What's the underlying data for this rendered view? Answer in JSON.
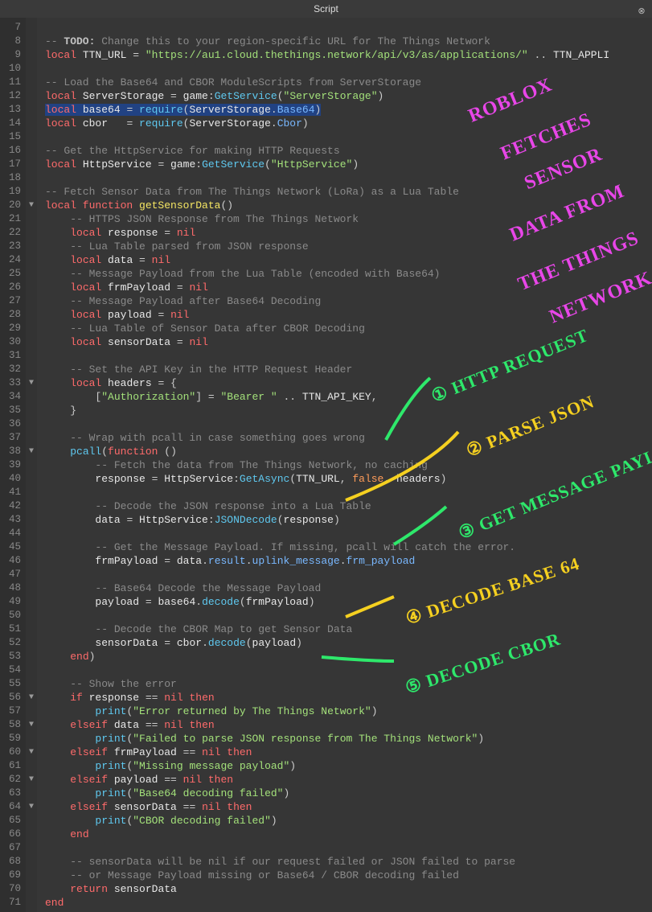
{
  "window": {
    "title": "Script"
  },
  "first_line_no": 7,
  "fold_lines": [
    20,
    33,
    38,
    56,
    58,
    60,
    62,
    64
  ],
  "highlight_line": 13,
  "code_lines": [
    [],
    [
      [
        "c-comment",
        "-- "
      ],
      [
        "c-todo",
        "TODO:"
      ],
      [
        "c-comment",
        " Change this to your region-specific URL for The Things Network"
      ]
    ],
    [
      [
        "c-kw",
        "local"
      ],
      [
        "c-var",
        " TTN_URL "
      ],
      [
        "c-op",
        "= "
      ],
      [
        "c-str",
        "\"https://au1.cloud.thethings.network/api/v3/as/applications/\""
      ],
      [
        "c-op",
        " .. "
      ],
      [
        "c-var",
        "TTN_APPLI"
      ]
    ],
    [],
    [
      [
        "c-comment",
        "-- Load the Base64 and CBOR ModuleScripts from ServerStorage"
      ]
    ],
    [
      [
        "c-kw",
        "local"
      ],
      [
        "c-var",
        " ServerStorage "
      ],
      [
        "c-op",
        "= "
      ],
      [
        "c-var",
        "game"
      ],
      [
        "c-op",
        ":"
      ],
      [
        "c-func",
        "GetService"
      ],
      [
        "c-op",
        "("
      ],
      [
        "c-str",
        "\"ServerStorage\""
      ],
      [
        "c-op",
        ")"
      ]
    ],
    [
      [
        "c-kw",
        "local"
      ],
      [
        "c-var",
        " base64 "
      ],
      [
        "c-op",
        "= "
      ],
      [
        "c-func",
        "require"
      ],
      [
        "c-op",
        "("
      ],
      [
        "c-var",
        "ServerStorage"
      ],
      [
        "c-op",
        "."
      ],
      [
        "c-prop",
        "Base64"
      ],
      [
        "c-op",
        ")"
      ]
    ],
    [
      [
        "c-kw",
        "local"
      ],
      [
        "c-var",
        " cbor   "
      ],
      [
        "c-op",
        "= "
      ],
      [
        "c-func",
        "require"
      ],
      [
        "c-op",
        "("
      ],
      [
        "c-var",
        "ServerStorage"
      ],
      [
        "c-op",
        "."
      ],
      [
        "c-prop",
        "Cbor"
      ],
      [
        "c-op",
        ")"
      ]
    ],
    [],
    [
      [
        "c-comment",
        "-- Get the HttpService for making HTTP Requests"
      ]
    ],
    [
      [
        "c-kw",
        "local"
      ],
      [
        "c-var",
        " HttpService "
      ],
      [
        "c-op",
        "= "
      ],
      [
        "c-var",
        "game"
      ],
      [
        "c-op",
        ":"
      ],
      [
        "c-func",
        "GetService"
      ],
      [
        "c-op",
        "("
      ],
      [
        "c-str",
        "\"HttpService\""
      ],
      [
        "c-op",
        ")"
      ]
    ],
    [],
    [
      [
        "c-comment",
        "-- Fetch Sensor Data from The Things Network (LoRa) as a Lua Table"
      ]
    ],
    [
      [
        "c-kw",
        "local function "
      ],
      [
        "c-fn",
        "getSensorData"
      ],
      [
        "c-op",
        "()"
      ]
    ],
    [
      [
        "c-comment",
        "    -- HTTPS JSON Response from The Things Network"
      ]
    ],
    [
      [
        "c-op",
        "    "
      ],
      [
        "c-kw",
        "local"
      ],
      [
        "c-var",
        " response "
      ],
      [
        "c-op",
        "= "
      ],
      [
        "c-kw",
        "nil"
      ]
    ],
    [
      [
        "c-comment",
        "    -- Lua Table parsed from JSON response"
      ]
    ],
    [
      [
        "c-op",
        "    "
      ],
      [
        "c-kw",
        "local"
      ],
      [
        "c-var",
        " data "
      ],
      [
        "c-op",
        "= "
      ],
      [
        "c-kw",
        "nil"
      ]
    ],
    [
      [
        "c-comment",
        "    -- Message Payload from the Lua Table (encoded with Base64)"
      ]
    ],
    [
      [
        "c-op",
        "    "
      ],
      [
        "c-kw",
        "local"
      ],
      [
        "c-var",
        " frmPayload "
      ],
      [
        "c-op",
        "= "
      ],
      [
        "c-kw",
        "nil"
      ]
    ],
    [
      [
        "c-comment",
        "    -- Message Payload after Base64 Decoding"
      ]
    ],
    [
      [
        "c-op",
        "    "
      ],
      [
        "c-kw",
        "local"
      ],
      [
        "c-var",
        " payload "
      ],
      [
        "c-op",
        "= "
      ],
      [
        "c-kw",
        "nil"
      ]
    ],
    [
      [
        "c-comment",
        "    -- Lua Table of Sensor Data after CBOR Decoding"
      ]
    ],
    [
      [
        "c-op",
        "    "
      ],
      [
        "c-kw",
        "local"
      ],
      [
        "c-var",
        " sensorData "
      ],
      [
        "c-op",
        "= "
      ],
      [
        "c-kw",
        "nil"
      ]
    ],
    [],
    [
      [
        "c-comment",
        "    -- Set the API Key in the HTTP Request Header"
      ]
    ],
    [
      [
        "c-op",
        "    "
      ],
      [
        "c-kw",
        "local"
      ],
      [
        "c-var",
        " headers "
      ],
      [
        "c-op",
        "= {"
      ]
    ],
    [
      [
        "c-op",
        "        ["
      ],
      [
        "c-str",
        "\"Authorization\""
      ],
      [
        "c-op",
        "] = "
      ],
      [
        "c-str",
        "\"Bearer \""
      ],
      [
        "c-op",
        " .. "
      ],
      [
        "c-var",
        "TTN_API_KEY"
      ],
      [
        "c-op",
        ","
      ]
    ],
    [
      [
        "c-op",
        "    }"
      ]
    ],
    [],
    [
      [
        "c-comment",
        "    -- Wrap with pcall in case something goes wrong"
      ]
    ],
    [
      [
        "c-op",
        "    "
      ],
      [
        "c-func",
        "pcall"
      ],
      [
        "c-op",
        "("
      ],
      [
        "c-kw",
        "function"
      ],
      [
        "c-op",
        " ()"
      ]
    ],
    [
      [
        "c-comment",
        "        -- Fetch the data from The Things Network, no caching"
      ]
    ],
    [
      [
        "c-op",
        "        "
      ],
      [
        "c-var",
        "response "
      ],
      [
        "c-op",
        "= "
      ],
      [
        "c-var",
        "HttpService"
      ],
      [
        "c-op",
        ":"
      ],
      [
        "c-func",
        "GetAsync"
      ],
      [
        "c-op",
        "("
      ],
      [
        "c-var",
        "TTN_URL"
      ],
      [
        "c-op",
        ", "
      ],
      [
        "c-bool",
        "false"
      ],
      [
        "c-op",
        ", "
      ],
      [
        "c-var",
        "headers"
      ],
      [
        "c-op",
        ")"
      ]
    ],
    [],
    [
      [
        "c-comment",
        "        -- Decode the JSON response into a Lua Table"
      ]
    ],
    [
      [
        "c-op",
        "        "
      ],
      [
        "c-var",
        "data "
      ],
      [
        "c-op",
        "= "
      ],
      [
        "c-var",
        "HttpService"
      ],
      [
        "c-op",
        ":"
      ],
      [
        "c-func",
        "JSONDecode"
      ],
      [
        "c-op",
        "("
      ],
      [
        "c-var",
        "response"
      ],
      [
        "c-op",
        ")"
      ]
    ],
    [],
    [
      [
        "c-comment",
        "        -- Get the Message Payload. If missing, pcall will catch the error."
      ]
    ],
    [
      [
        "c-op",
        "        "
      ],
      [
        "c-var",
        "frmPayload "
      ],
      [
        "c-op",
        "= "
      ],
      [
        "c-var",
        "data"
      ],
      [
        "c-op",
        "."
      ],
      [
        "c-prop",
        "result"
      ],
      [
        "c-op",
        "."
      ],
      [
        "c-prop",
        "uplink_message"
      ],
      [
        "c-op",
        "."
      ],
      [
        "c-prop",
        "frm_payload"
      ]
    ],
    [],
    [
      [
        "c-comment",
        "        -- Base64 Decode the Message Payload"
      ]
    ],
    [
      [
        "c-op",
        "        "
      ],
      [
        "c-var",
        "payload "
      ],
      [
        "c-op",
        "= "
      ],
      [
        "c-var",
        "base64"
      ],
      [
        "c-op",
        "."
      ],
      [
        "c-func",
        "decode"
      ],
      [
        "c-op",
        "("
      ],
      [
        "c-var",
        "frmPayload"
      ],
      [
        "c-op",
        ")"
      ]
    ],
    [],
    [
      [
        "c-comment",
        "        -- Decode the CBOR Map to get Sensor Data"
      ]
    ],
    [
      [
        "c-op",
        "        "
      ],
      [
        "c-var",
        "sensorData "
      ],
      [
        "c-op",
        "= "
      ],
      [
        "c-var",
        "cbor"
      ],
      [
        "c-op",
        "."
      ],
      [
        "c-func",
        "decode"
      ],
      [
        "c-op",
        "("
      ],
      [
        "c-var",
        "payload"
      ],
      [
        "c-op",
        ")"
      ]
    ],
    [
      [
        "c-op",
        "    "
      ],
      [
        "c-kw",
        "end"
      ],
      [
        "c-op",
        ")"
      ]
    ],
    [],
    [
      [
        "c-comment",
        "    -- Show the error"
      ]
    ],
    [
      [
        "c-op",
        "    "
      ],
      [
        "c-kw",
        "if"
      ],
      [
        "c-var",
        " response "
      ],
      [
        "c-op",
        "== "
      ],
      [
        "c-kw",
        "nil"
      ],
      [
        "c-op",
        " "
      ],
      [
        "c-kw",
        "then"
      ]
    ],
    [
      [
        "c-op",
        "        "
      ],
      [
        "c-func",
        "print"
      ],
      [
        "c-op",
        "("
      ],
      [
        "c-str",
        "\"Error returned by The Things Network\""
      ],
      [
        "c-op",
        ")"
      ]
    ],
    [
      [
        "c-op",
        "    "
      ],
      [
        "c-kw",
        "elseif"
      ],
      [
        "c-var",
        " data "
      ],
      [
        "c-op",
        "== "
      ],
      [
        "c-kw",
        "nil"
      ],
      [
        "c-op",
        " "
      ],
      [
        "c-kw",
        "then"
      ]
    ],
    [
      [
        "c-op",
        "        "
      ],
      [
        "c-func",
        "print"
      ],
      [
        "c-op",
        "("
      ],
      [
        "c-str",
        "\"Failed to parse JSON response from The Things Network\""
      ],
      [
        "c-op",
        ")"
      ]
    ],
    [
      [
        "c-op",
        "    "
      ],
      [
        "c-kw",
        "elseif"
      ],
      [
        "c-var",
        " frmPayload "
      ],
      [
        "c-op",
        "== "
      ],
      [
        "c-kw",
        "nil"
      ],
      [
        "c-op",
        " "
      ],
      [
        "c-kw",
        "then"
      ]
    ],
    [
      [
        "c-op",
        "        "
      ],
      [
        "c-func",
        "print"
      ],
      [
        "c-op",
        "("
      ],
      [
        "c-str",
        "\"Missing message payload\""
      ],
      [
        "c-op",
        ")"
      ]
    ],
    [
      [
        "c-op",
        "    "
      ],
      [
        "c-kw",
        "elseif"
      ],
      [
        "c-var",
        " payload "
      ],
      [
        "c-op",
        "== "
      ],
      [
        "c-kw",
        "nil"
      ],
      [
        "c-op",
        " "
      ],
      [
        "c-kw",
        "then"
      ]
    ],
    [
      [
        "c-op",
        "        "
      ],
      [
        "c-func",
        "print"
      ],
      [
        "c-op",
        "("
      ],
      [
        "c-str",
        "\"Base64 decoding failed\""
      ],
      [
        "c-op",
        ")"
      ]
    ],
    [
      [
        "c-op",
        "    "
      ],
      [
        "c-kw",
        "elseif"
      ],
      [
        "c-var",
        " sensorData "
      ],
      [
        "c-op",
        "== "
      ],
      [
        "c-kw",
        "nil"
      ],
      [
        "c-op",
        " "
      ],
      [
        "c-kw",
        "then"
      ]
    ],
    [
      [
        "c-op",
        "        "
      ],
      [
        "c-func",
        "print"
      ],
      [
        "c-op",
        "("
      ],
      [
        "c-str",
        "\"CBOR decoding failed\""
      ],
      [
        "c-op",
        ")"
      ]
    ],
    [
      [
        "c-op",
        "    "
      ],
      [
        "c-kw",
        "end"
      ]
    ],
    [],
    [
      [
        "c-comment",
        "    -- sensorData will be nil if our request failed or JSON failed to parse"
      ]
    ],
    [
      [
        "c-comment",
        "    -- or Message Payload missing or Base64 / CBOR decoding failed"
      ]
    ],
    [
      [
        "c-op",
        "    "
      ],
      [
        "c-kw",
        "return"
      ],
      [
        "c-var",
        " sensorData"
      ]
    ],
    [
      [
        "c-kw",
        "end"
      ]
    ]
  ],
  "annotations": {
    "title_big": [
      "ROBLOX",
      "FETCHES",
      "SENSOR",
      "DATA FROM",
      "THE THINGS",
      "NETWORK"
    ],
    "steps": [
      {
        "num": "①",
        "label": "HTTP REQUEST",
        "color": "green"
      },
      {
        "num": "②",
        "label": "PARSE JSON",
        "color": "yellow"
      },
      {
        "num": "③",
        "label": "GET MESSAGE PAYLOAD",
        "color": "green"
      },
      {
        "num": "④",
        "label": "DECODE BASE 64",
        "color": "yellow"
      },
      {
        "num": "⑤",
        "label": "DECODE CBOR",
        "color": "green"
      }
    ]
  }
}
